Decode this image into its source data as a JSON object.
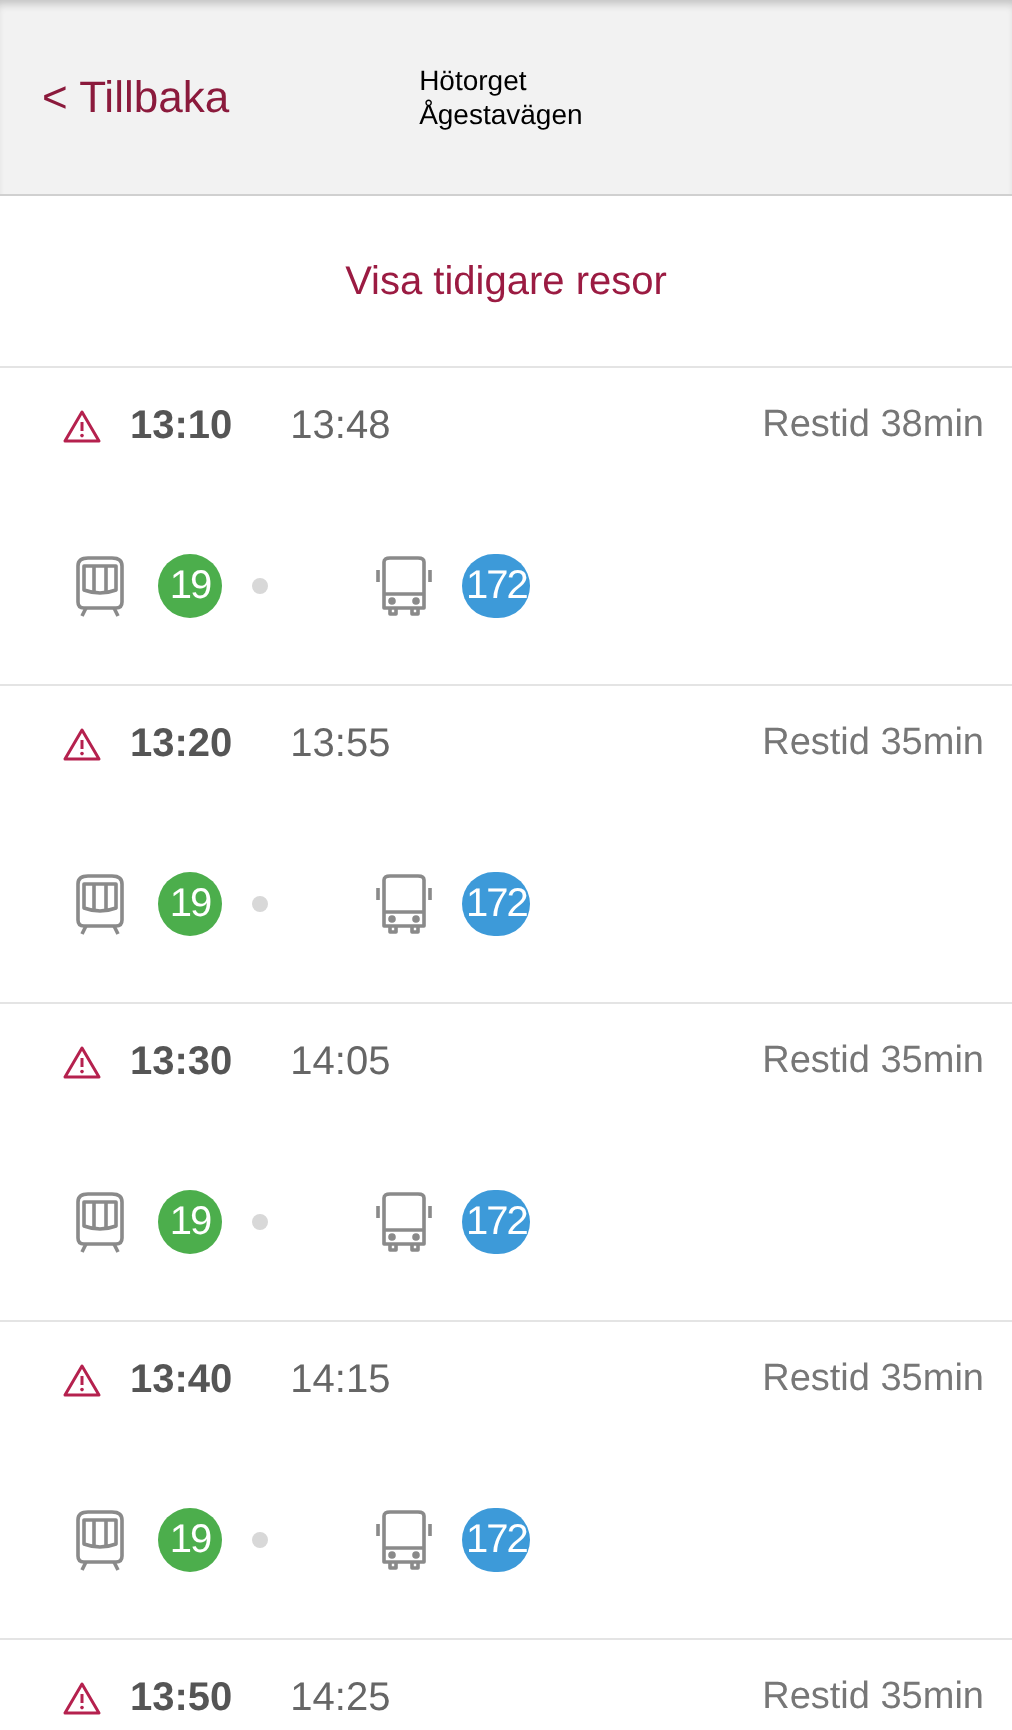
{
  "header": {
    "back": "< Tillbaka",
    "from": "Hötorget",
    "to": "Ågestavägen"
  },
  "earlier_link": "Visa tidigare resor",
  "trips": [
    {
      "warning": true,
      "depart": "13:10",
      "arrive": "13:48",
      "duration": "Restid 38min",
      "legs": [
        {
          "kind": "train",
          "line": "19",
          "color": "#4cae4c"
        },
        {
          "kind": "bus",
          "line": "172",
          "color": "#3d9ad9"
        }
      ]
    },
    {
      "warning": true,
      "depart": "13:20",
      "arrive": "13:55",
      "duration": "Restid 35min",
      "legs": [
        {
          "kind": "train",
          "line": "19",
          "color": "#4cae4c"
        },
        {
          "kind": "bus",
          "line": "172",
          "color": "#3d9ad9"
        }
      ]
    },
    {
      "warning": true,
      "depart": "13:30",
      "arrive": "14:05",
      "duration": "Restid 35min",
      "legs": [
        {
          "kind": "train",
          "line": "19",
          "color": "#4cae4c"
        },
        {
          "kind": "bus",
          "line": "172",
          "color": "#3d9ad9"
        }
      ]
    },
    {
      "warning": true,
      "depart": "13:40",
      "arrive": "14:15",
      "duration": "Restid 35min",
      "legs": [
        {
          "kind": "train",
          "line": "19",
          "color": "#4cae4c"
        },
        {
          "kind": "bus",
          "line": "172",
          "color": "#3d9ad9"
        }
      ]
    },
    {
      "warning": true,
      "depart": "13:50",
      "arrive": "14:25",
      "duration": "Restid 35min"
    }
  ]
}
